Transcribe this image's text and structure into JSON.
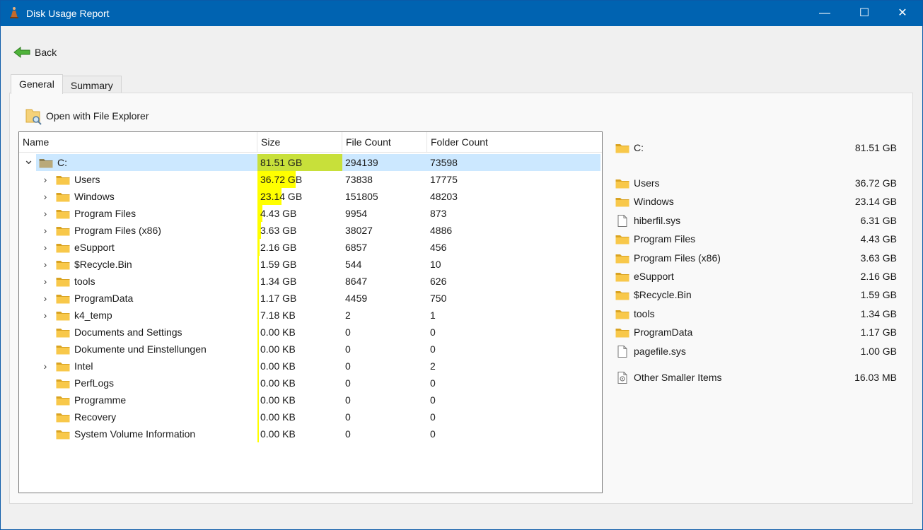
{
  "window": {
    "title": "Disk Usage Report",
    "minimize_glyph": "—",
    "maximize_glyph": "☐",
    "close_glyph": "✕"
  },
  "toolbar": {
    "back_label": "Back",
    "open_explorer_label": "Open with File Explorer"
  },
  "tabs": [
    {
      "label": "General",
      "active": true
    },
    {
      "label": "Summary",
      "active": false
    }
  ],
  "tree": {
    "columns": {
      "name": "Name",
      "size": "Size",
      "file_count": "File Count",
      "folder_count": "Folder Count"
    },
    "rows": [
      {
        "name": "C:",
        "level": 0,
        "expander": "expanded",
        "size": "81.51 GB",
        "files": "294139",
        "folders": "73598",
        "share": 1.0,
        "selected": true
      },
      {
        "name": "Users",
        "level": 1,
        "expander": "collapsed",
        "size": "36.72 GB",
        "files": "73838",
        "folders": "17775",
        "share": 0.4505
      },
      {
        "name": "Windows",
        "level": 1,
        "expander": "collapsed",
        "size": "23.14 GB",
        "files": "151805",
        "folders": "48203",
        "share": 0.2839
      },
      {
        "name": "Program Files",
        "level": 1,
        "expander": "collapsed",
        "size": "4.43 GB",
        "files": "9954",
        "folders": "873",
        "share": 0.0543
      },
      {
        "name": "Program Files (x86)",
        "level": 1,
        "expander": "collapsed",
        "size": "3.63 GB",
        "files": "38027",
        "folders": "4886",
        "share": 0.0445
      },
      {
        "name": "eSupport",
        "level": 1,
        "expander": "collapsed",
        "size": "2.16 GB",
        "files": "6857",
        "folders": "456",
        "share": 0.0265
      },
      {
        "name": "$Recycle.Bin",
        "level": 1,
        "expander": "collapsed",
        "size": "1.59 GB",
        "files": "544",
        "folders": "10",
        "share": 0.0195
      },
      {
        "name": "tools",
        "level": 1,
        "expander": "collapsed",
        "size": "1.34 GB",
        "files": "8647",
        "folders": "626",
        "share": 0.0164
      },
      {
        "name": "ProgramData",
        "level": 1,
        "expander": "collapsed",
        "size": "1.17 GB",
        "files": "4459",
        "folders": "750",
        "share": 0.0144
      },
      {
        "name": "k4_temp",
        "level": 1,
        "expander": "collapsed",
        "size": "7.18 KB",
        "files": "2",
        "folders": "1",
        "share": 0.012
      },
      {
        "name": "Documents and Settings",
        "level": 1,
        "expander": "none",
        "size": "0.00 KB",
        "files": "0",
        "folders": "0",
        "share": 0.012
      },
      {
        "name": "Dokumente und Einstellungen",
        "level": 1,
        "expander": "none",
        "size": "0.00 KB",
        "files": "0",
        "folders": "0",
        "share": 0.012
      },
      {
        "name": "Intel",
        "level": 1,
        "expander": "collapsed",
        "size": "0.00 KB",
        "files": "0",
        "folders": "2",
        "share": 0.012
      },
      {
        "name": "PerfLogs",
        "level": 1,
        "expander": "none",
        "size": "0.00 KB",
        "files": "0",
        "folders": "0",
        "share": 0.012
      },
      {
        "name": "Programme",
        "level": 1,
        "expander": "none",
        "size": "0.00 KB",
        "files": "0",
        "folders": "0",
        "share": 0.012
      },
      {
        "name": "Recovery",
        "level": 1,
        "expander": "none",
        "size": "0.00 KB",
        "files": "0",
        "folders": "0",
        "share": 0.012
      },
      {
        "name": "System Volume Information",
        "level": 1,
        "expander": "none",
        "size": "0.00 KB",
        "files": "0",
        "folders": "0",
        "share": 0.012
      }
    ]
  },
  "summary": {
    "root": {
      "name": "C:",
      "size": "81.51 GB",
      "icon": "folder-icon"
    },
    "items": [
      {
        "name": "Users",
        "size": "36.72 GB",
        "icon": "folder-icon"
      },
      {
        "name": "Windows",
        "size": "23.14 GB",
        "icon": "folder-icon"
      },
      {
        "name": "hiberfil.sys",
        "size": "6.31 GB",
        "icon": "file-icon"
      },
      {
        "name": "Program Files",
        "size": "4.43 GB",
        "icon": "folder-icon"
      },
      {
        "name": "Program Files (x86)",
        "size": "3.63 GB",
        "icon": "folder-icon"
      },
      {
        "name": "eSupport",
        "size": "2.16 GB",
        "icon": "folder-icon"
      },
      {
        "name": "$Recycle.Bin",
        "size": "1.59 GB",
        "icon": "folder-icon"
      },
      {
        "name": "tools",
        "size": "1.34 GB",
        "icon": "folder-icon"
      },
      {
        "name": "ProgramData",
        "size": "1.17 GB",
        "icon": "folder-icon"
      },
      {
        "name": "pagefile.sys",
        "size": "1.00 GB",
        "icon": "file-icon"
      }
    ],
    "other": {
      "name": "Other Smaller Items",
      "size": "16.03 MB",
      "icon": "gear-file-icon"
    }
  },
  "colors": {
    "titlebar": "#0063b1",
    "selection": "#cce8ff",
    "bar": "#ffff00",
    "bar_top": "#c8e03a",
    "folder": "#f8c84a"
  }
}
